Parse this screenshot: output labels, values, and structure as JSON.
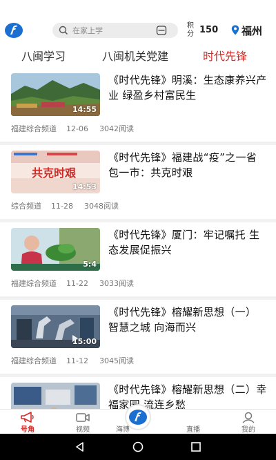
{
  "header": {
    "logo_icon": "fujian-network-logo-icon",
    "search_placeholder": "在家上学",
    "points_label": "积分",
    "points_value": "150",
    "location": "福州"
  },
  "tabs": [
    {
      "label": "八闽学习",
      "active": false
    },
    {
      "label": "八闽机关党建",
      "active": false
    },
    {
      "label": "时代先锋",
      "active": true
    }
  ],
  "feed": [
    {
      "title": "《时代先锋》明溪：生态康养兴产业 绿盈乡村富民生",
      "source": "福建综合频道",
      "date": "12-06",
      "reads": "3042阅读",
      "duration": "14:55"
    },
    {
      "title": "《时代先锋》福建战“疫”之一省包一市：共克时艰",
      "source": "综合频道",
      "date": "11-28",
      "reads": "3048阅读",
      "duration": "14:53",
      "thumb_text": "共克时艰"
    },
    {
      "title": "《时代先锋》厦门：牢记嘱托 生态发展促振兴",
      "source": "福建综合频道",
      "date": "11-22",
      "reads": "3033阅读",
      "duration": "5:4"
    },
    {
      "title": "《时代先锋》榕耀新思想（一） 智慧之城 向海而兴",
      "source": "福建综合频道",
      "date": "11-12",
      "reads": "3045阅读",
      "duration": "15:00"
    },
    {
      "title": "《时代先锋》榕耀新思想（二）幸福家园 流连乡愁",
      "source": "",
      "date": "",
      "reads": "",
      "duration": ""
    }
  ],
  "bottom_nav": [
    {
      "label": "号角",
      "icon": "horn-icon",
      "active": true
    },
    {
      "label": "视频",
      "icon": "video-icon",
      "active": false
    },
    {
      "label": "海博",
      "icon": "haibo-icon",
      "active": false
    },
    {
      "label": "直播",
      "icon": "live-icon",
      "active": false
    },
    {
      "label": "我的",
      "icon": "profile-icon",
      "active": false
    }
  ],
  "colors": {
    "accent": "#d82a26",
    "logo_blue": "#1a6fd1"
  }
}
